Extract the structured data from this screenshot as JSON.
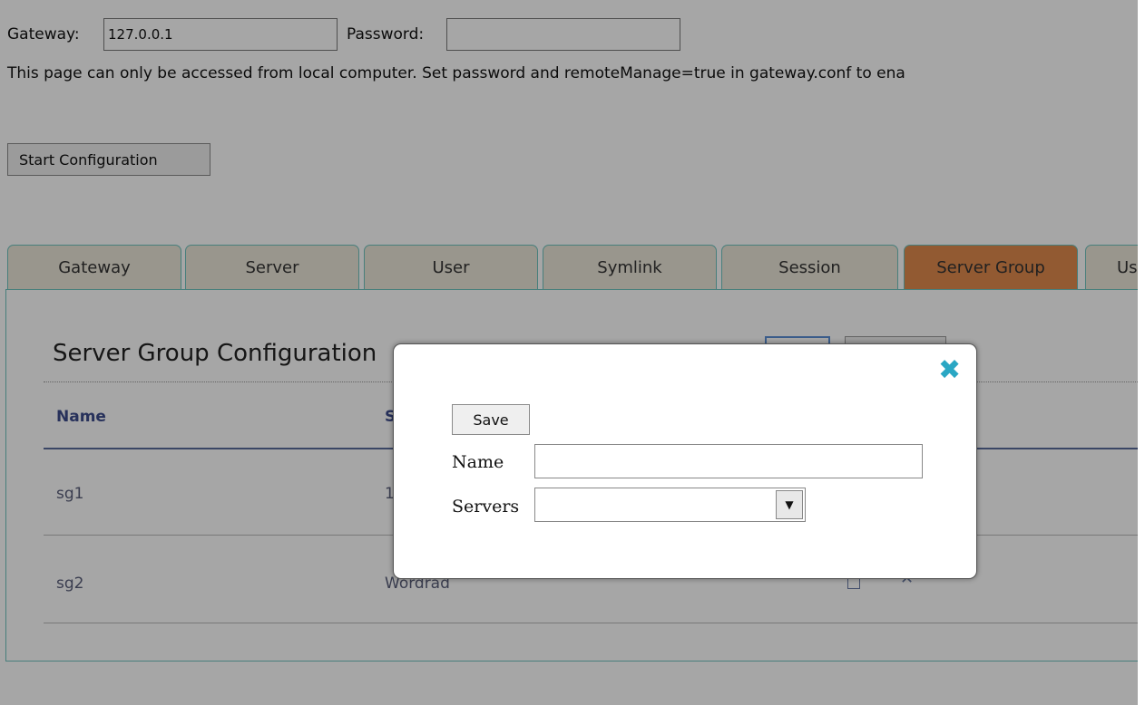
{
  "gateway": {
    "label": "Gateway:",
    "value": "127.0.0.1",
    "password_label": "Password:",
    "password_value": "",
    "notice": "This page can only be accessed from local computer. Set password and remoteManage=true in gateway.conf to ena"
  },
  "start_configuration_label": "Start Configuration",
  "tabs": [
    {
      "label": "Gateway"
    },
    {
      "label": "Server"
    },
    {
      "label": "User"
    },
    {
      "label": "Symlink"
    },
    {
      "label": "Session"
    },
    {
      "label": "Server Group",
      "active": true
    },
    {
      "label": "Us"
    }
  ],
  "section": {
    "title": "Server Group Configuration",
    "columns": [
      "Name",
      "S"
    ],
    "rows": [
      {
        "name": "sg1",
        "servers": "1"
      },
      {
        "name": "sg2",
        "servers": "Wordrad"
      }
    ]
  },
  "modal": {
    "save_label": "Save",
    "name_label": "Name",
    "name_value": "",
    "servers_label": "Servers",
    "servers_value": "",
    "close_icon": "close-icon"
  },
  "colors": {
    "tab_bg": "#ece6d9",
    "tab_active_bg": "#e08a4d",
    "tab_border": "#6fc4bf",
    "header_text": "#3d4c8c",
    "close_icon": "#2aa7c4",
    "overlay": "rgba(0,0,0,0.35)"
  }
}
